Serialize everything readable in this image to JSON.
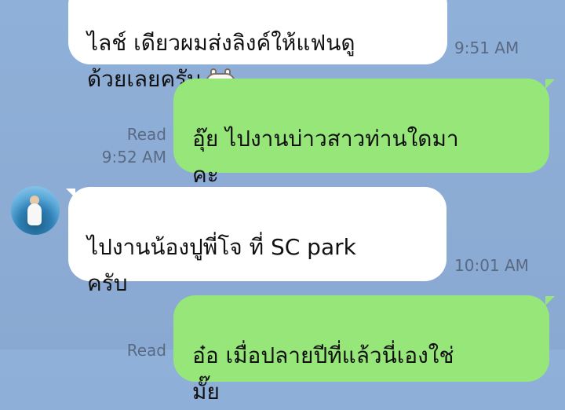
{
  "messages": [
    {
      "id": "msg1",
      "direction": "incoming",
      "text": "ไลช์ เดียวผมส่งลิงค์ให้แฟนดู\nด้วยเลยครับ",
      "time": "9:51 AM",
      "sticker": "bunny-emoji"
    },
    {
      "id": "msg2",
      "direction": "outgoing",
      "text": "อุ๊ย ไปงานบ่าวสาวท่านใดมา\nคะ",
      "status": "Read",
      "time": "9:52 AM"
    },
    {
      "id": "msg3",
      "direction": "incoming",
      "text": "ไปงานน้องปูพี่โจ ที่ SC park\nครับ",
      "time": "10:01 AM"
    },
    {
      "id": "msg4",
      "direction": "outgoing",
      "text": "อ๋อ เมื่อปลายปีที่แล้วนี่เองใช่\nมั๊ย",
      "status": "Read"
    }
  ],
  "colors": {
    "background": "#8fb0d8",
    "incoming_bubble": "#ffffff",
    "outgoing_bubble": "#96e67a"
  },
  "icons": {
    "avatar": "contact-avatar",
    "sticker": "bunny-emoji-icon"
  }
}
